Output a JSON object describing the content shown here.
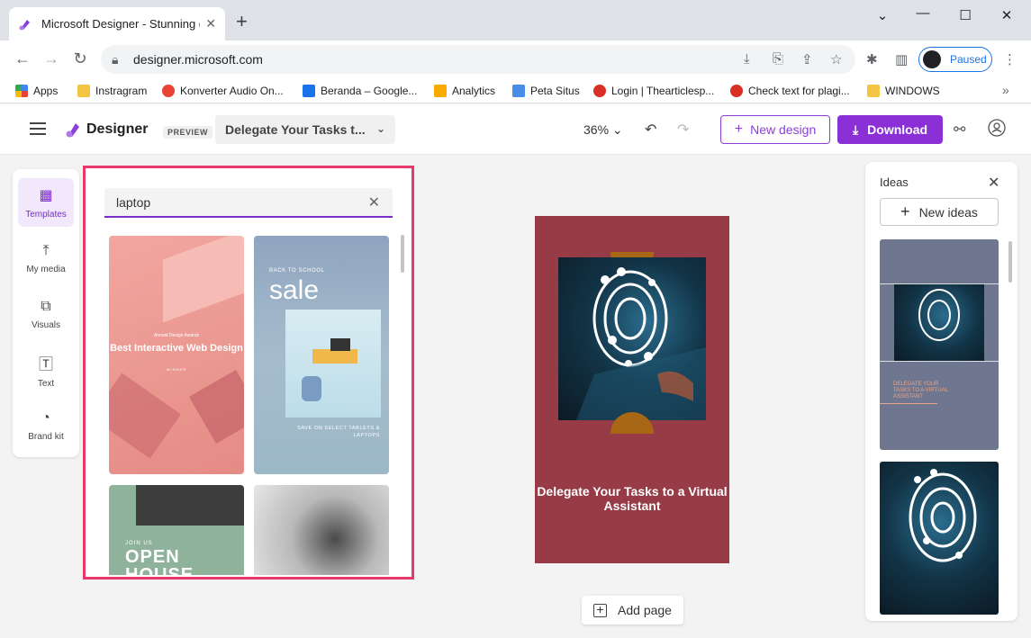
{
  "browser": {
    "tab_title": "Microsoft Designer - Stunning d",
    "url": "designer.microsoft.com",
    "profile_status": "Paused",
    "bookmarks": [
      {
        "label": "Apps",
        "color": "#4285f4"
      },
      {
        "label": "Instragram",
        "color": "#f4c542"
      },
      {
        "label": "Konverter Audio On...",
        "color": "#e94335"
      },
      {
        "label": "Beranda – Google...",
        "color": "#1a73e8"
      },
      {
        "label": "Analytics",
        "color": "#f9ab00"
      },
      {
        "label": "Peta Situs",
        "color": "#4a8de8"
      },
      {
        "label": "Login | Thearticlesp...",
        "color": "#d93025"
      },
      {
        "label": "Check text for plagi...",
        "color": "#d93025"
      },
      {
        "label": "WINDOWS",
        "color": "#f4c542"
      }
    ]
  },
  "header": {
    "app_name": "Designer",
    "preview_badge": "PREVIEW",
    "design_title": "Delegate Your Tasks t...",
    "zoom": "36%",
    "new_design_label": "New design",
    "download_label": "Download"
  },
  "rail": {
    "items": [
      {
        "label": "Templates",
        "icon": "templates-icon",
        "active": true
      },
      {
        "label": "My media",
        "icon": "upload-icon",
        "active": false
      },
      {
        "label": "Visuals",
        "icon": "visuals-icon",
        "active": false
      },
      {
        "label": "Text",
        "icon": "text-icon",
        "active": false
      },
      {
        "label": "Brand kit",
        "icon": "palette-icon",
        "active": false
      }
    ]
  },
  "templates": {
    "search_value": "laptop",
    "cards": [
      {
        "small": "Annual Design Awards",
        "big": "Best Interactive Web Design",
        "foot": "WINNER"
      },
      {
        "small": "BACK TO SCHOOL",
        "big": "sale",
        "foot": "SAVE ON SELECT TABLETS & LAPTOPS"
      },
      {
        "small": "JOIN US",
        "big": "OPEN HOUSE"
      },
      {}
    ]
  },
  "canvas": {
    "headline": "Delegate Your Tasks to a Virtual Assistant",
    "add_page_label": "Add page"
  },
  "ideas": {
    "title": "Ideas",
    "new_ideas_label": "New ideas",
    "idea1_text": "DELEGATE YOUR TASKS TO A VIRTUAL ASSISTANT"
  },
  "colors": {
    "accent": "#8b2fd6",
    "highlight_border": "#e8386a",
    "canvas_bg": "#973b47"
  }
}
